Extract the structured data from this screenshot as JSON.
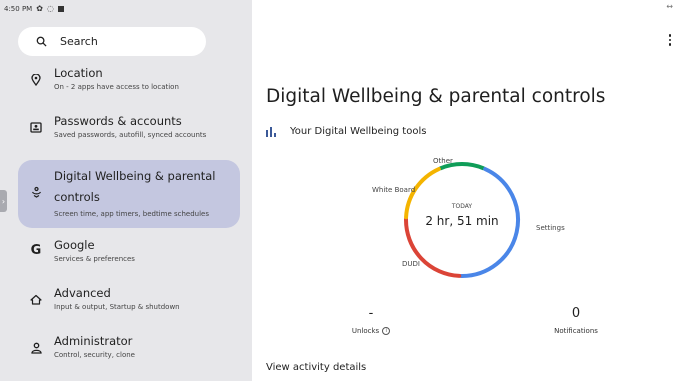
{
  "status_bar": {
    "time": "4:50 PM"
  },
  "search": {
    "placeholder": "Search"
  },
  "sidebar": {
    "items": [
      {
        "title": "Location",
        "subtitle": "On - 2 apps have access to location",
        "icon": "location-pin-icon"
      },
      {
        "title": "Passwords & accounts",
        "subtitle": "Saved passwords, autofill, synced accounts",
        "icon": "id-card-icon"
      },
      {
        "title_line1": "Digital Wellbeing & parental",
        "title_line2": "controls",
        "subtitle": "Screen time, app timers, bedtime schedules",
        "icon": "wellbeing-icon",
        "selected": true
      },
      {
        "title": "Google",
        "subtitle": "Services & preferences",
        "icon": "google-g-icon"
      },
      {
        "title": "Advanced",
        "subtitle": "Input & output, Startup & shutdown",
        "icon": "home-outline-icon"
      },
      {
        "title": "Administrator",
        "subtitle": "Control, security, clone",
        "icon": "person-icon"
      }
    ]
  },
  "main": {
    "title": "Digital Wellbeing & parental controls",
    "tools_label": "Your Digital Wellbeing tools",
    "donut": {
      "center_caption": "TODAY",
      "center_value": "2 hr, 51 min",
      "segments": [
        {
          "name": "Settings",
          "fraction": 0.44,
          "color": "#4a86e8"
        },
        {
          "name": "DUDI",
          "fraction": 0.25,
          "color": "#db4437"
        },
        {
          "name": "White Board",
          "fraction": 0.18,
          "color": "#f4b400"
        },
        {
          "name": "Other",
          "fraction": 0.13,
          "color": "#0f9d58"
        }
      ]
    },
    "stats": {
      "unlocks_value": "-",
      "unlocks_label": "Unlocks",
      "notifications_value": "0",
      "notifications_label": "Notifications"
    },
    "view_activity": "View activity details"
  },
  "colors": {
    "sidebar_bg": "#e7e7ea",
    "selected_item_bg": "#c4c7e0"
  }
}
